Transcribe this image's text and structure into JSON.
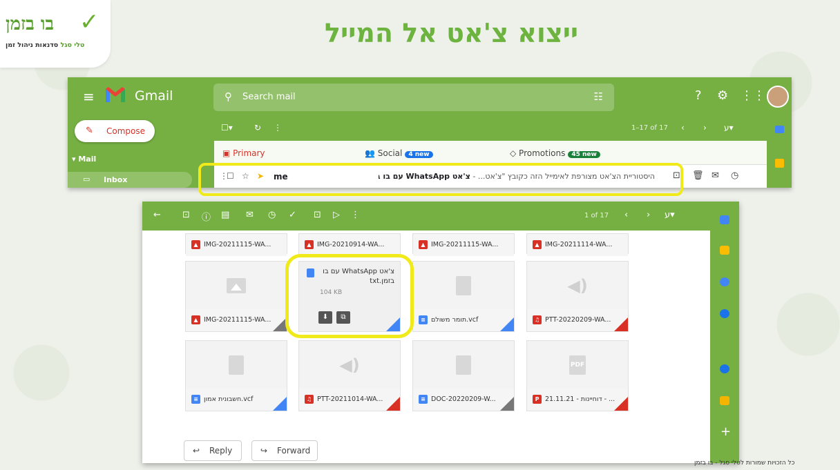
{
  "slide": {
    "headline": "ייצוא צ'אט אל המייל",
    "logo_title": "בו בזמן",
    "logo_name": "טלי סגל",
    "logo_tagline": "סדנאות ניהול זמן",
    "footer": "כל הזכויות שמורות לטלי סגל - בו בזמן"
  },
  "gmail": {
    "app_name": "Gmail",
    "search_placeholder": "Search mail",
    "compose_label": "Compose",
    "mail_label": "Mail",
    "inbox_label": "Inbox",
    "pagination": "1–17 of 17",
    "tabs": [
      {
        "label": "Primary"
      },
      {
        "label": "Social",
        "badge": "4 new",
        "badge_color": "#1a73e8"
      },
      {
        "label": "Promotions",
        "badge": "45 new",
        "badge_color": "#188038"
      }
    ],
    "email_row": {
      "from": "me",
      "subject": "צ'אט WhatsApp עם בו בזמן",
      "snippet": "היסטוריית הצ'אט מצורפת לאימייל הזה כקובץ \"צ'אט..."
    }
  },
  "message": {
    "pagination": "1 of 17",
    "attachments_row1": [
      {
        "name": "IMG-20211115-WA...",
        "type": "image"
      },
      {
        "name": "IMG-20210914-WA...",
        "type": "image"
      },
      {
        "name": "IMG-20211115-WA...",
        "type": "image"
      },
      {
        "name": "IMG-20211114-WA...",
        "type": "image"
      }
    ],
    "attachments_row2": [
      {
        "name": "IMG-20211115-WA...",
        "type": "image"
      },
      {
        "name": "תומר משולם.vcf",
        "type": "doc"
      },
      {
        "name": "PTT-20220209-WA...",
        "type": "audio"
      }
    ],
    "highlighted_file": {
      "name": "צ'אט WhatsApp עם בו בזמן.txt",
      "size": "104 KB"
    },
    "attachments_row3": [
      {
        "name": "חשבונית אמון.vcf",
        "type": "doc"
      },
      {
        "name": "PTT-20211014-WA...",
        "type": "audio"
      },
      {
        "name": "DOC-20220209-W...",
        "type": "doc"
      },
      {
        "name": "21.11.21 - דוחיינות - ...",
        "type": "pdf"
      }
    ],
    "reply_label": "Reply",
    "forward_label": "Forward"
  },
  "colors": {
    "gmail_theme": "#76b043",
    "highlight": "#f1ea1b",
    "accent_red": "#d93025"
  }
}
